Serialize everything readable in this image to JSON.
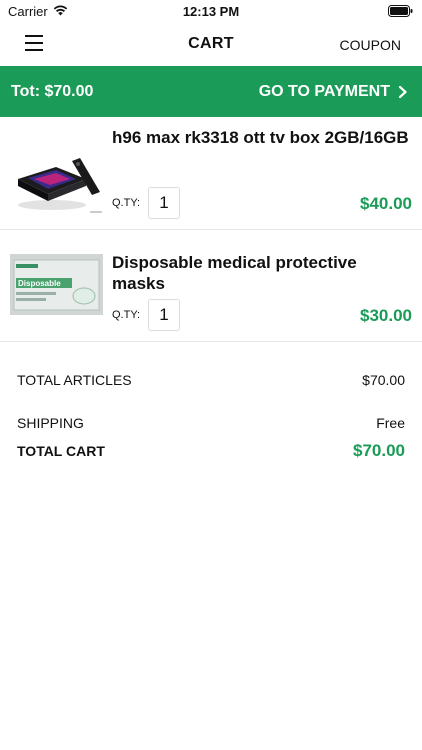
{
  "status_bar": {
    "carrier": "Carrier",
    "time": "12:13 PM"
  },
  "nav": {
    "title": "CART",
    "coupon_label": "COUPON",
    "menu_icon": "hamburger-menu-icon"
  },
  "payment_bar": {
    "total_label": "Tot: $70.00",
    "button_label": "GO TO PAYMENT",
    "background_color": "#1a9b57"
  },
  "items": [
    {
      "name": "h96 max rk3318 ott tv box 2GB/16GB",
      "qty_label": "Q.TY:",
      "qty": "1",
      "price": "$40.00"
    },
    {
      "name": "Disposable medical protective masks",
      "qty_label": "Q.TY:",
      "qty": "1",
      "price": "$30.00"
    }
  ],
  "summary": {
    "articles_label": "TOTAL ARTICLES",
    "articles_value": "$70.00",
    "shipping_label": "SHIPPING",
    "shipping_value": "Free",
    "total_label": "TOTAL CART",
    "total_value": "$70.00"
  },
  "mask_box_text": "Disposable",
  "accent_color": "#1a9b57"
}
